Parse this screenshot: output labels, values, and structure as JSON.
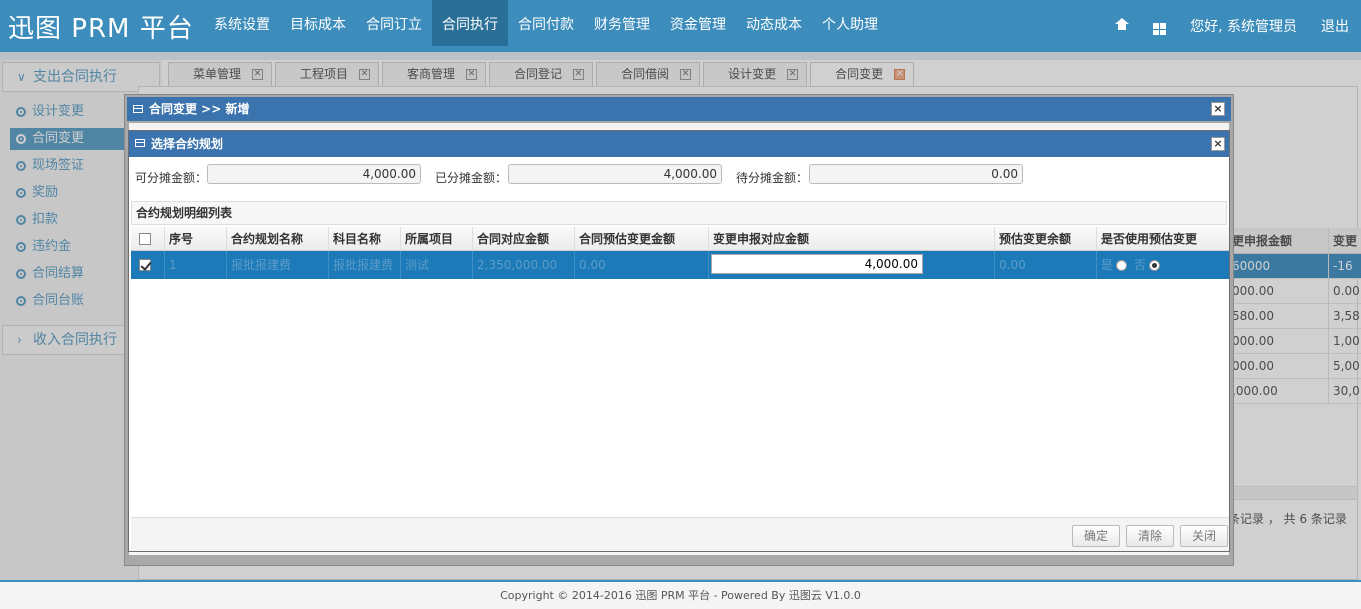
{
  "app": {
    "logo": "迅图 PRM 平台"
  },
  "nav": {
    "items": [
      "系统设置",
      "目标成本",
      "合同订立",
      "合同执行",
      "合同付款",
      "财务管理",
      "资金管理",
      "动态成本",
      "个人助理"
    ],
    "active_index": 3
  },
  "top_right": {
    "home_icon": "home-icon",
    "grid_icon": "grid-icon",
    "greeting": "您好, 系统管理员",
    "logout": "退出"
  },
  "sidebar": {
    "group1": "支出合同执行",
    "items": [
      "设计变更",
      "合同变更",
      "现场签证",
      "奖励",
      "扣款",
      "违约金",
      "合同结算",
      "合同台账"
    ],
    "active_index": 1,
    "group2": "收入合同执行"
  },
  "tabs": [
    "菜单管理",
    "工程项目",
    "客商管理",
    "合同登记",
    "合同借阅",
    "设计变更",
    "合同变更"
  ],
  "active_tab": 6,
  "background_grid": {
    "headers": [
      "更申报金额",
      "变更"
    ],
    "rows": [
      [
        "60000",
        "-16"
      ],
      [
        "000.00",
        "0.00"
      ],
      [
        "580.00",
        "3,58"
      ],
      [
        "000.00",
        "1,00"
      ],
      [
        "000.00",
        "5,00"
      ],
      [
        ",000.00",
        "30,0"
      ]
    ],
    "footer": "条记录 ， 共 6 条记录"
  },
  "outer_dialog": {
    "title": "合同变更 >> 新增"
  },
  "inner_dialog": {
    "title": "选择合约规划",
    "amounts": {
      "allocatable_label": "可分摊金额：",
      "allocatable_value": "4,000.00",
      "allocated_label": "已分摊金额：",
      "allocated_value": "4,000.00",
      "pending_label": "待分摊金额：",
      "pending_value": "0.00"
    },
    "section_title": "合约规划明细列表",
    "columns": [
      "序号",
      "合约规划名称",
      "科目名称",
      "所属项目",
      "合同对应金额",
      "合同预估变更金额",
      "变更申报对应金额",
      "预估变更余额",
      "是否使用预估变更"
    ],
    "rows": [
      {
        "no": "1",
        "plan_name": "报批报建费",
        "subject": "报批报建费",
        "project": "测试",
        "contract_amount": "2,350,000.00",
        "est_change": "0.00",
        "declared_amount": "4,000.00",
        "est_balance": "0.00",
        "yes_label": "是",
        "no_label": "否",
        "use_estimate": "否"
      }
    ],
    "buttons": {
      "confirm": "确定",
      "clear": "清除",
      "close": "关闭"
    }
  },
  "footer": {
    "copyright": "Copyright © 2014-2016 迅图 PRM 平台 - Powered By 迅图云 V1.0.0"
  },
  "colors": {
    "primary": "#3c8dbc",
    "dialog_bar": "#3a73ae",
    "row_selected": "#1b7ab7"
  }
}
